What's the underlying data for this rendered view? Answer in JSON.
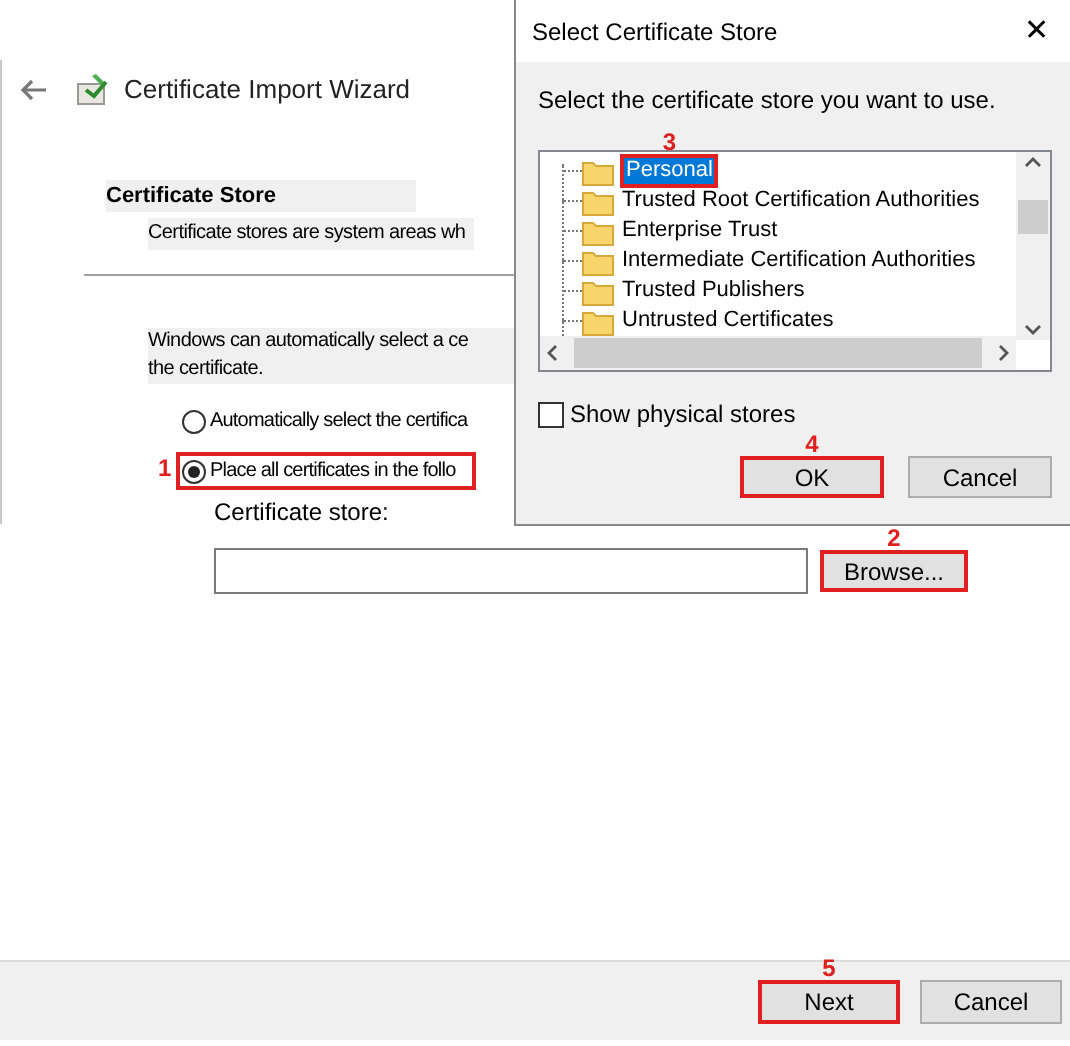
{
  "wizard": {
    "title": "Certificate Import Wizard",
    "section": {
      "heading": "Certificate Store",
      "description": "Certificate stores are system areas wh"
    },
    "intro": [
      "Windows can automatically select a ce",
      "the certificate."
    ],
    "options": [
      {
        "label": "Automatically select the certifica",
        "selected": false
      },
      {
        "label": "Place all certificates in the follo",
        "selected": true,
        "callout": "1"
      }
    ],
    "store_field": {
      "label": "Certificate store:"
    },
    "browse_button": {
      "label": "Browse...",
      "callout": "2"
    },
    "footer_buttons": [
      {
        "label": "Next",
        "callout": "5"
      },
      {
        "label": "Cancel"
      }
    ]
  },
  "dialog": {
    "title": "Select Certificate Store",
    "close": "✕",
    "prompt": "Select the certificate store you want to use.",
    "stores": [
      {
        "label": "Personal",
        "selected": true,
        "callout": "3"
      },
      {
        "label": "Trusted Root Certification Authorities",
        "selected": false
      },
      {
        "label": "Enterprise Trust",
        "selected": false
      },
      {
        "label": "Intermediate Certification Authorities",
        "selected": false
      },
      {
        "label": "Trusted Publishers",
        "selected": false
      },
      {
        "label": "Untrusted Certificates",
        "selected": false
      }
    ],
    "show_physical": {
      "label": "Show physical stores",
      "checked": false
    },
    "buttons": [
      {
        "label": "OK",
        "callout": "4"
      },
      {
        "label": "Cancel"
      }
    ]
  }
}
